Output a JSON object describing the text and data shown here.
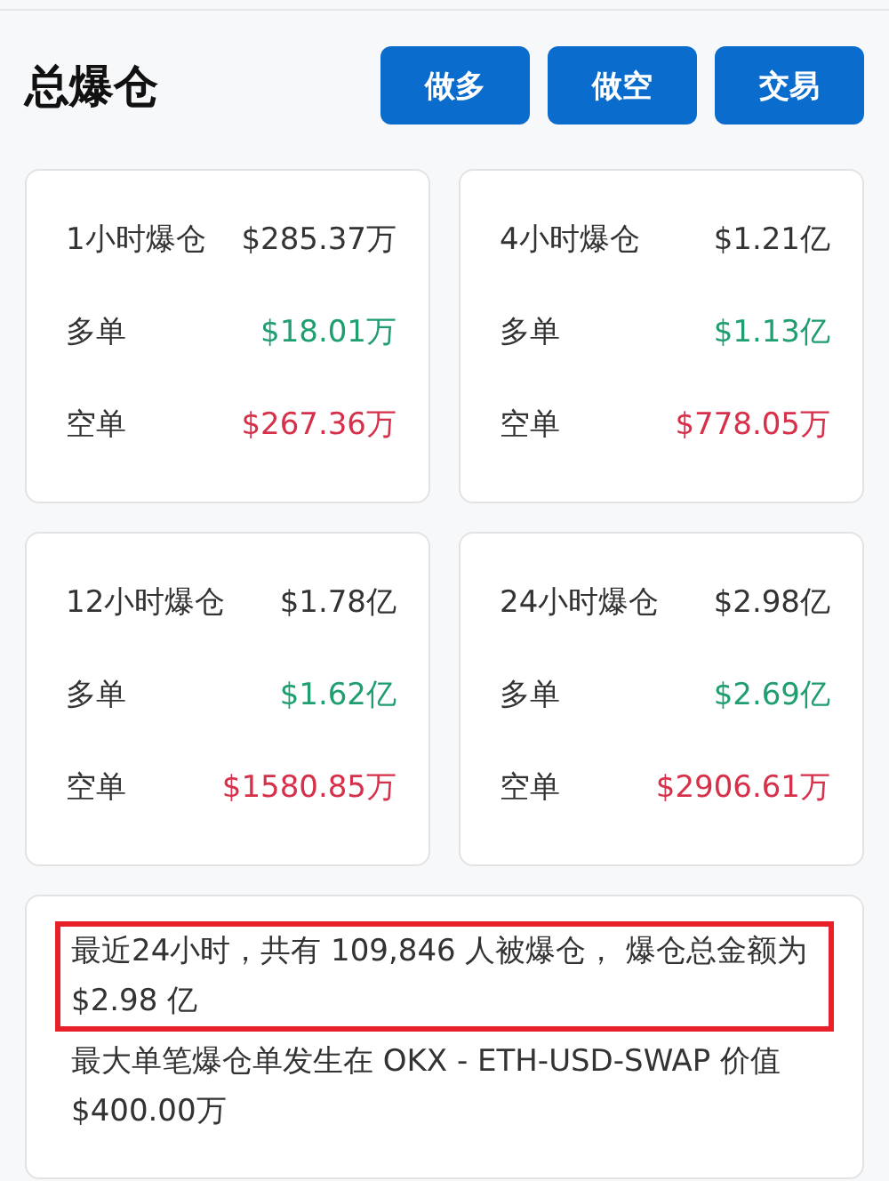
{
  "title": "总爆仓",
  "buttons": [
    "做多",
    "做空",
    "交易"
  ],
  "cards": [
    {
      "rows": [
        {
          "kind": "total",
          "label": "1小时爆仓",
          "value": "$285.37万"
        },
        {
          "kind": "long",
          "label": "多单",
          "value": "$18.01万"
        },
        {
          "kind": "short",
          "label": "空单",
          "value": "$267.36万"
        }
      ]
    },
    {
      "rows": [
        {
          "kind": "total",
          "label": "4小时爆仓",
          "value": "$1.21亿"
        },
        {
          "kind": "long",
          "label": "多单",
          "value": "$1.13亿"
        },
        {
          "kind": "short",
          "label": "空单",
          "value": "$778.05万"
        }
      ]
    },
    {
      "rows": [
        {
          "kind": "total",
          "label": "12小时爆仓",
          "value": "$1.78亿"
        },
        {
          "kind": "long",
          "label": "多单",
          "value": "$1.62亿"
        },
        {
          "kind": "short",
          "label": "空单",
          "value": "$1580.85万"
        }
      ]
    },
    {
      "rows": [
        {
          "kind": "total",
          "label": "24小时爆仓",
          "value": "$2.98亿"
        },
        {
          "kind": "long",
          "label": "多单",
          "value": "$2.69亿"
        },
        {
          "kind": "short",
          "label": "空单",
          "value": "$2906.61万"
        }
      ]
    }
  ],
  "summary": [
    {
      "text": "最近24小时，共有 109,846 人被爆仓， 爆仓总金额为 $2.98 亿",
      "highlighted": true
    },
    {
      "text": "最大单笔爆仓单发生在 OKX - ETH-USD-SWAP 价值 $400.00万",
      "highlighted": false
    }
  ]
}
